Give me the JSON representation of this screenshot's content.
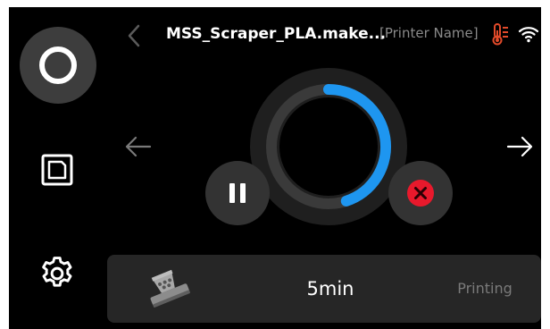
{
  "header": {
    "job_title": "MSS_Scraper_PLA.make...",
    "printer_name": "[Printer Name]"
  },
  "nav": {
    "items": [
      {
        "icon": "home-ring-icon"
      },
      {
        "icon": "files-icon"
      },
      {
        "icon": "gear-icon"
      }
    ]
  },
  "status": {
    "progress": 0.45,
    "time_remaining": "5min",
    "state": "Printing"
  },
  "colors": {
    "background": "#000000",
    "accent_progress": "#1e96f0",
    "cancel": "#e8192c",
    "thermo": "#e24a2a",
    "card": "#262626"
  },
  "icons": {
    "back": "chevron-left-icon",
    "thermo": "thermometer-icon",
    "wifi": "wifi-icon",
    "pause": "pause-icon",
    "cancel": "cancel-x-icon",
    "prev": "arrow-left-icon",
    "next": "arrow-right-icon"
  }
}
